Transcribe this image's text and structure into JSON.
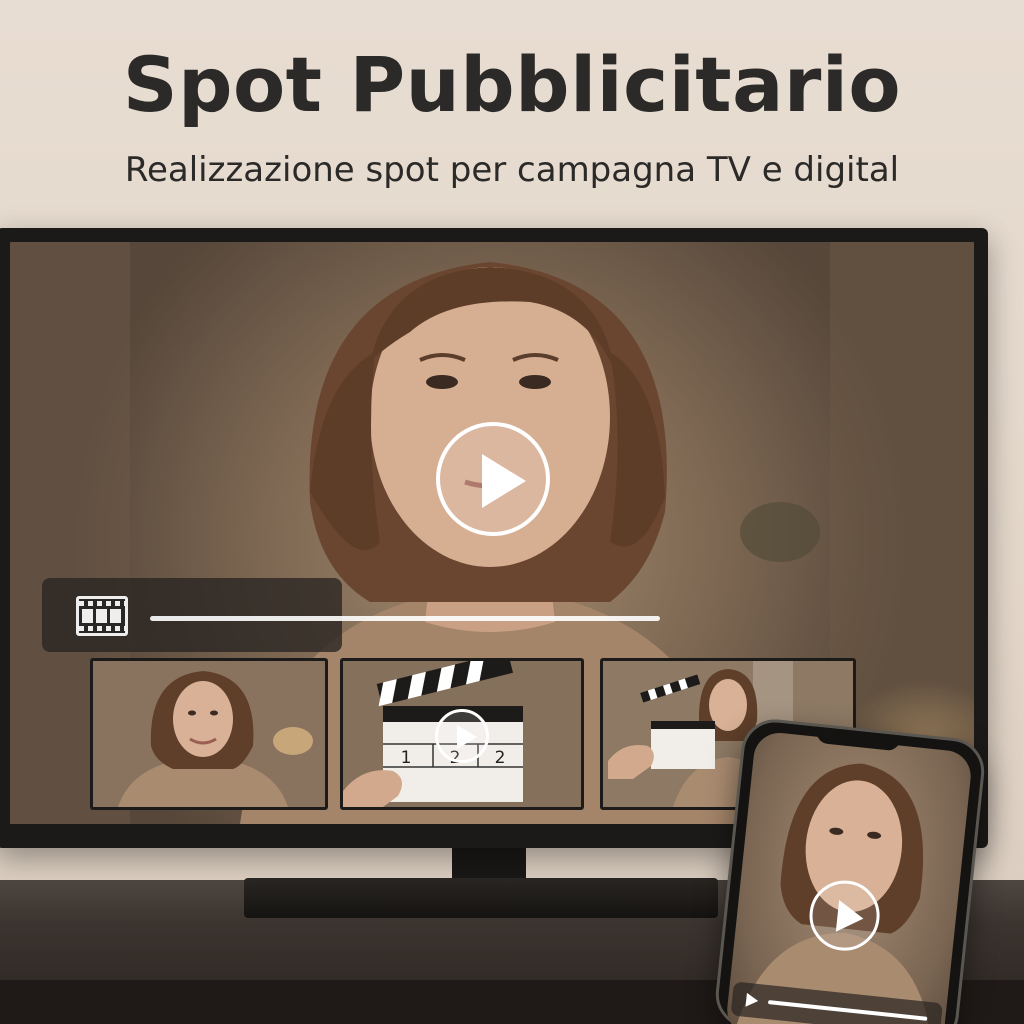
{
  "header": {
    "title": "Spot Pubblicitario",
    "subtitle": "Realizzazione spot per campagna TV e digital"
  },
  "icons": {
    "play": "play-icon",
    "film": "film-strip-icon"
  },
  "clapperboard": {
    "digits": [
      "1",
      "2",
      "2"
    ]
  },
  "colors": {
    "background": "#e5d9cc",
    "title_text": "#2b2a28",
    "tv_frame": "#1c1a18",
    "play_button": "#ffffff"
  }
}
